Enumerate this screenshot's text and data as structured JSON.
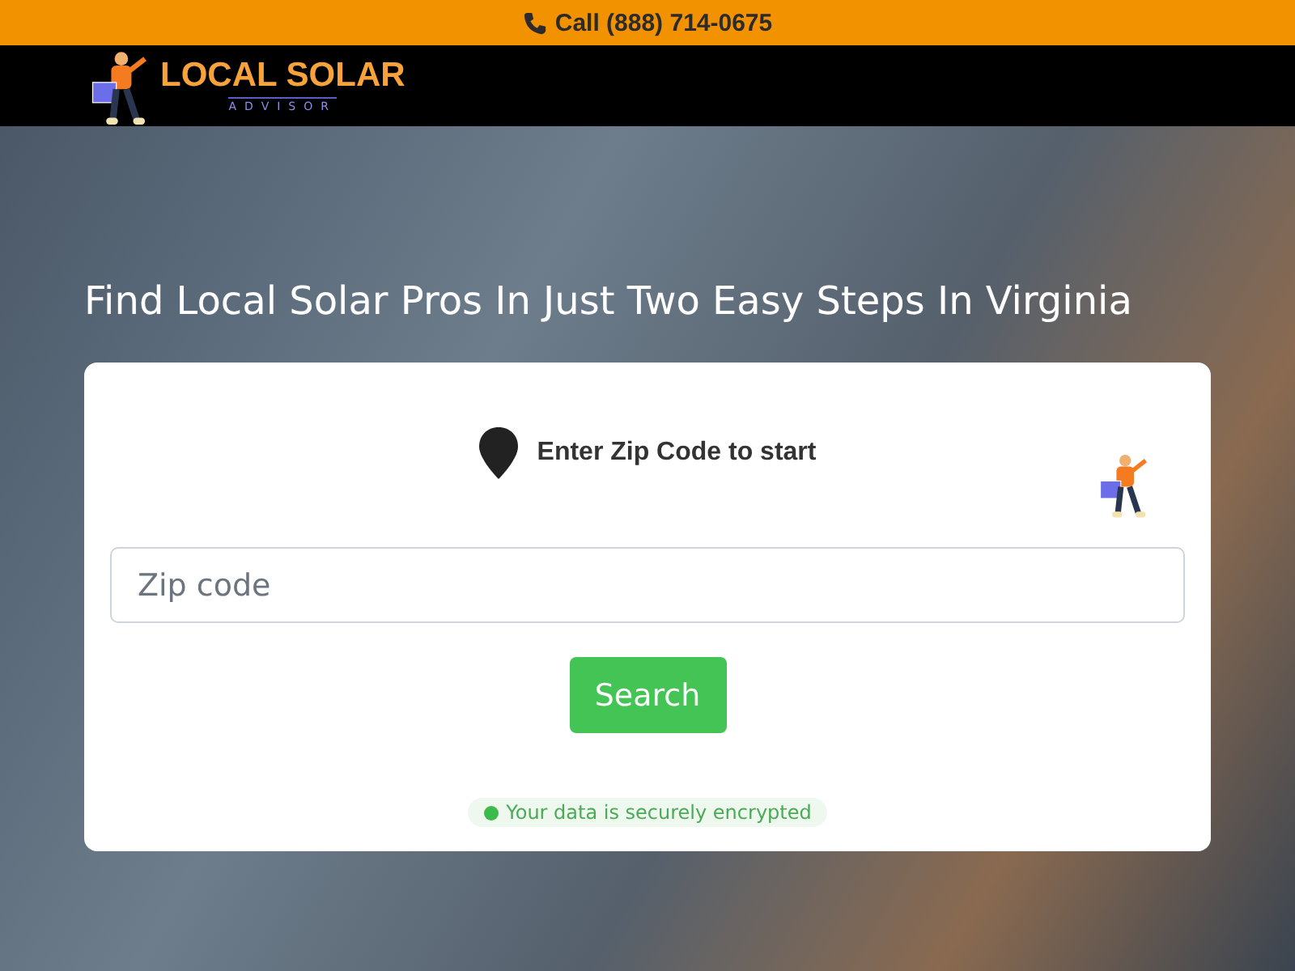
{
  "top_bar": {
    "phone_text": "Call (888) 714-0675"
  },
  "logo": {
    "name": "LOCAL SOLAR",
    "tagline": "ADVISOR"
  },
  "hero": {
    "title": "Find Local Solar Pros In Just Two Easy Steps In Virginia"
  },
  "form": {
    "heading": "Enter Zip Code to start",
    "zip_field": {
      "placeholder": "Zip code"
    },
    "button": "Search",
    "security_note": "Your data is securely encrypted"
  }
}
